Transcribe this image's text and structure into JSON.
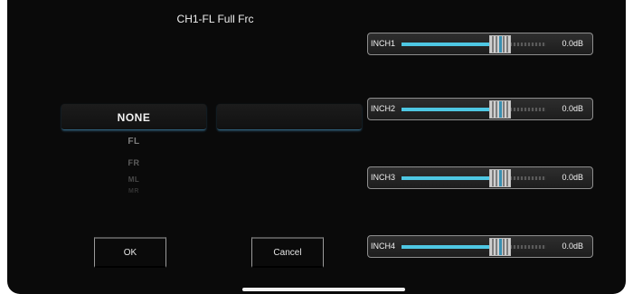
{
  "title": "CH1-FL Full Frc",
  "picker": {
    "items": [
      "NONE",
      "FL",
      "FR",
      "ML",
      "MR"
    ],
    "selected": "NONE"
  },
  "buttons": {
    "ok_label": "OK",
    "cancel_label": "Cancel"
  },
  "faders": [
    {
      "label": "INCH1",
      "value": "0.0dB",
      "level": 0.68
    },
    {
      "label": "INCH2",
      "value": "0.0dB",
      "level": 0.68
    },
    {
      "label": "INCH3",
      "value": "0.0dB",
      "level": 0.68
    },
    {
      "label": "INCH4",
      "value": "0.0dB",
      "level": 0.68
    }
  ],
  "colors": {
    "background": "#0a0a0a",
    "accent": "#4ec7e3"
  }
}
